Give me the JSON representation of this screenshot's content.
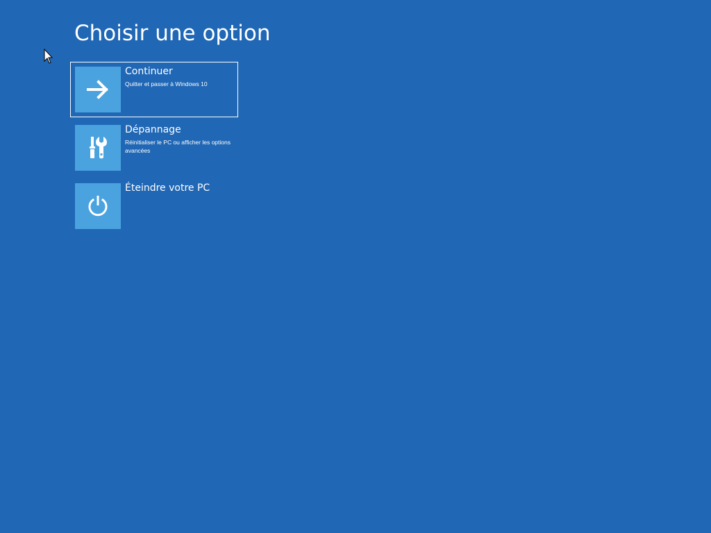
{
  "page": {
    "title": "Choisir une option"
  },
  "options": [
    {
      "title": "Continuer",
      "description": "Quitter et passer à Windows 10",
      "icon": "arrow-right-icon"
    },
    {
      "title": "Dépannage",
      "description": "Réinitialiser le PC ou afficher les options avancées",
      "icon": "tools-icon"
    },
    {
      "title": "Éteindre votre PC",
      "description": "",
      "icon": "power-icon"
    }
  ],
  "colors": {
    "background": "#2067b5",
    "tile": "#4aa3df",
    "text": "#ffffff",
    "selection_border": "#ffffff"
  }
}
